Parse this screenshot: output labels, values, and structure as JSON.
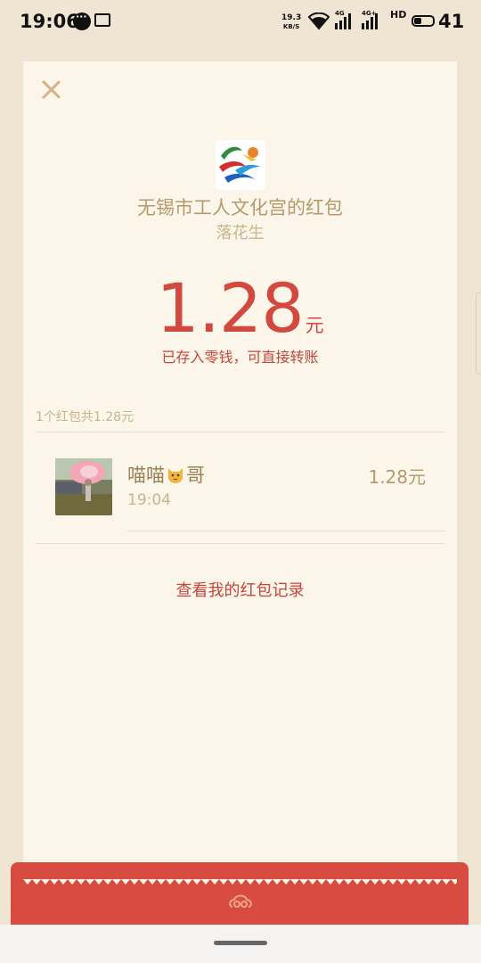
{
  "status_bar": {
    "time": "19:06",
    "net_speed_value": "19.3",
    "net_speed_unit": "KB/S",
    "signal1_label": "4G",
    "signal2_label": "4G+",
    "hd_label": "HD",
    "battery_level": "41"
  },
  "envelope": {
    "sender_title": "无锡市工人文化宫的红包",
    "sender_subtitle": "落花生",
    "amount": "1.28",
    "amount_unit": "元",
    "stored_note": "已存入零钱，可直接转账",
    "summary": "1个红包共1.28元"
  },
  "receivers": [
    {
      "name_before_emoji": "喵喵",
      "emoji": "cat-face-emoji",
      "name_after_emoji": "哥",
      "time": "19:04",
      "amount": "1.28元"
    }
  ],
  "history_link": "查看我的红包记录",
  "colors": {
    "background": "#EFE5D2",
    "card": "#FBF6E9",
    "accent_red": "#D84B40",
    "gold_text": "#B59A6B"
  },
  "icons": {
    "close": "close-icon",
    "emblem": "envelope-emblem-icon",
    "logo": "workers-palace-logo"
  }
}
